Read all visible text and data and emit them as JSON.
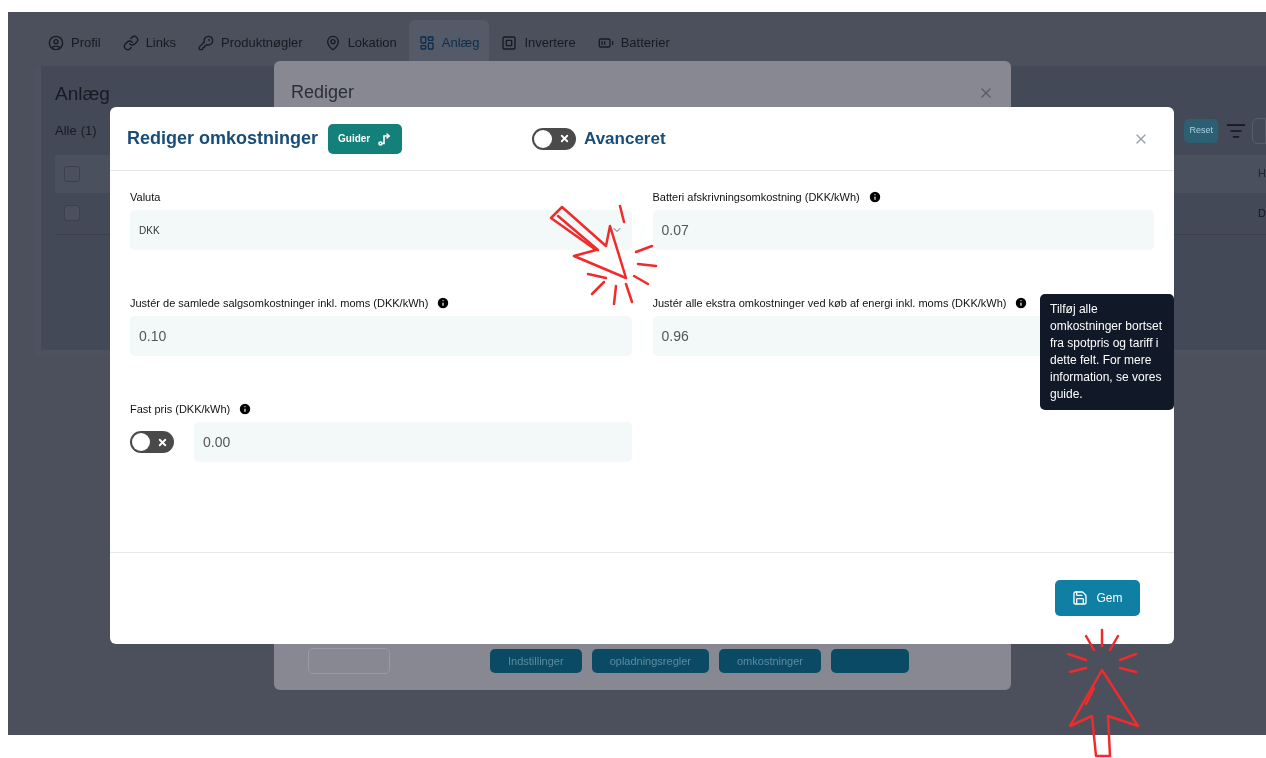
{
  "background_page": {
    "tabs": [
      {
        "label": "Profil",
        "selected": false
      },
      {
        "label": "Links",
        "selected": false
      },
      {
        "label": "Produktnøgler",
        "selected": false
      },
      {
        "label": "Lokation",
        "selected": false
      },
      {
        "label": "Anlæg",
        "selected": true
      },
      {
        "label": "Invertere",
        "selected": false
      },
      {
        "label": "Batterier",
        "selected": false
      }
    ],
    "panel": {
      "title": "Anlæg",
      "filter_label": "Alle",
      "filter_count": "(1)",
      "reset_button": "Reset",
      "table": {
        "header": {
          "checked": false,
          "column_2": "H"
        },
        "rows": [
          {
            "checked": false,
            "column_2": "D"
          }
        ]
      }
    }
  },
  "edit_dialog": {
    "title": "Rediger",
    "buttons": [
      "Indstillinger",
      "opladningsregler",
      "omkostninger"
    ]
  },
  "cost_dialog": {
    "title": "Rediger omkostninger",
    "guide_button": "Guider",
    "advanced_toggle": {
      "label": "Avanceret",
      "on": false
    },
    "fields": [
      {
        "kind": "select",
        "label": "Valuta",
        "info": false,
        "value": "DKK"
      },
      {
        "kind": "input",
        "label": "Batteri afskrivningsomkostning (DKK/kWh)",
        "info": true,
        "value": "0.07"
      },
      {
        "kind": "input",
        "label": "Justér de samlede salgsomkostninger inkl. moms (DKK/kWh)",
        "info": true,
        "value": "0.10"
      },
      {
        "kind": "input",
        "label": "Justér alle ekstra omkostninger ved køb af energi inkl. moms (DKK/kWh)",
        "info": true,
        "value": "0.96"
      },
      {
        "kind": "toggle_input",
        "label": "Fast pris (DKK/kWh)",
        "info": true,
        "on": false,
        "value": "0.00"
      }
    ],
    "tooltip": "Tilføj alle omkostninger bortset fra spotpris og tariff i dette felt. For mere information, se vores guide.",
    "save_button": "Gem"
  }
}
